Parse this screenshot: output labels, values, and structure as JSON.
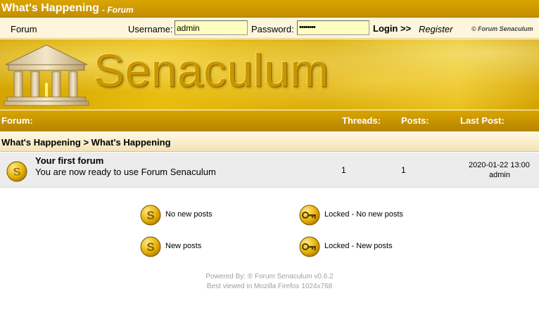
{
  "header": {
    "site_title": "What's Happening",
    "sub_title": "- Forum"
  },
  "nav": {
    "forum_link": "Forum",
    "username_label": "Username:",
    "username_value": "admin",
    "password_label": "Password:",
    "password_value": "••••••••",
    "login_label": "Login >>",
    "register_label": "Register",
    "copyright": "© Forum Senaculum"
  },
  "banner": {
    "text": "Senaculum",
    "logo_icon": "temple-icon"
  },
  "table": {
    "headers": {
      "forum": "Forum:",
      "threads": "Threads:",
      "posts": "Posts:",
      "last_post": "Last Post:"
    },
    "breadcrumb": "What's Happening > What's Happening",
    "rows": [
      {
        "name": "Your first forum",
        "description": "You are now ready to use Forum Senaculum",
        "threads": "1",
        "posts": "1",
        "last_post_date": "2020-01-22 13:00",
        "last_post_user": "admin",
        "icon": "new-posts-icon"
      }
    ]
  },
  "legend": {
    "no_new_posts": "No new posts",
    "new_posts": "New posts",
    "locked_no_new": "Locked - No new posts",
    "locked_new": "Locked - New posts"
  },
  "footer": {
    "powered_by": "Powered By: ® Forum Senaculum v0.6.2",
    "best_viewed": "Best viewed in Mozilla Firefox 1024x768"
  },
  "colors": {
    "gold": "#d9a500",
    "banner_gold": "#e8bd10",
    "row_grey": "#ececec",
    "input_yellow": "#ffffc0"
  }
}
